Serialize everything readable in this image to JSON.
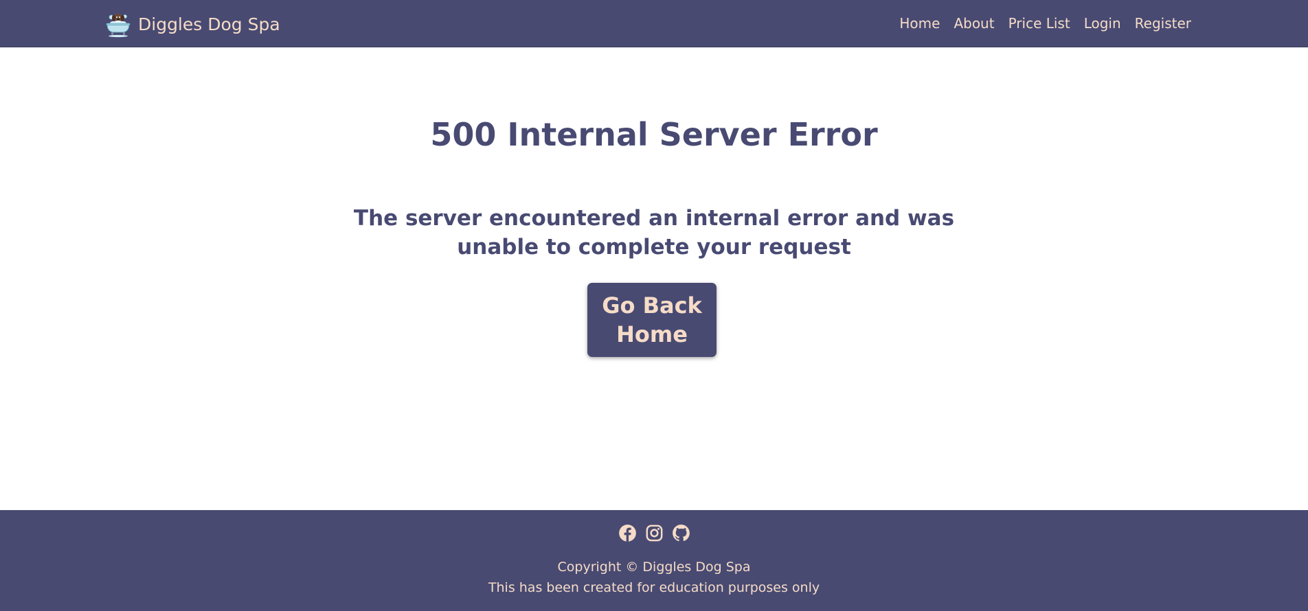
{
  "navbar": {
    "brand": {
      "name": "Diggles Dog Spa",
      "logo_icon": "dog-in-bathtub-icon"
    },
    "links": [
      {
        "label": "Home"
      },
      {
        "label": "About"
      },
      {
        "label": "Price List"
      },
      {
        "label": "Login"
      },
      {
        "label": "Register"
      }
    ]
  },
  "main": {
    "title": "500 Internal Server Error",
    "message": "The server encountered an internal error and was unable to complete your request",
    "button_label": "Go Back Home"
  },
  "footer": {
    "social_icons": [
      "facebook-icon",
      "instagram-icon",
      "github-icon"
    ],
    "copyright": "Copyright © Diggles Dog Spa",
    "note": "This has been created for education purposes only"
  },
  "colors": {
    "primary": "#484a72",
    "accent_text": "#f6dcc7",
    "background": "#ffffff"
  }
}
